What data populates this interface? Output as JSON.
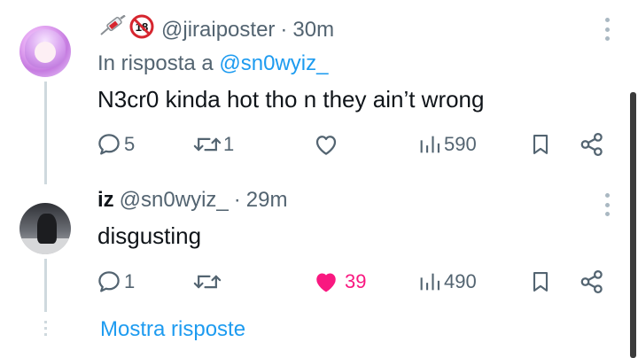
{
  "tweets": [
    {
      "handle": "@jiraiposter",
      "time": "30m",
      "emojis": [
        "syringe-icon",
        "no-under-18-icon"
      ],
      "reply_prefix": "In risposta a ",
      "reply_mention": "@sn0wyiz_",
      "text": "N3cr0 kinda hot tho n they ain’t wrong",
      "replies": "5",
      "retweets": "1",
      "likes": "",
      "views": "590"
    },
    {
      "display_name": "iz",
      "handle": "@sn0wyiz_",
      "time": "29m",
      "text": "disgusting",
      "replies": "1",
      "retweets": "",
      "likes": "39",
      "views": "490"
    }
  ],
  "separator": "·",
  "show_replies_label": "Mostra risposte",
  "colors": {
    "text": "#0f1419",
    "muted": "#536471",
    "link": "#1d9bf0",
    "like_active": "#f91880",
    "thread_line": "#cfd9de"
  }
}
